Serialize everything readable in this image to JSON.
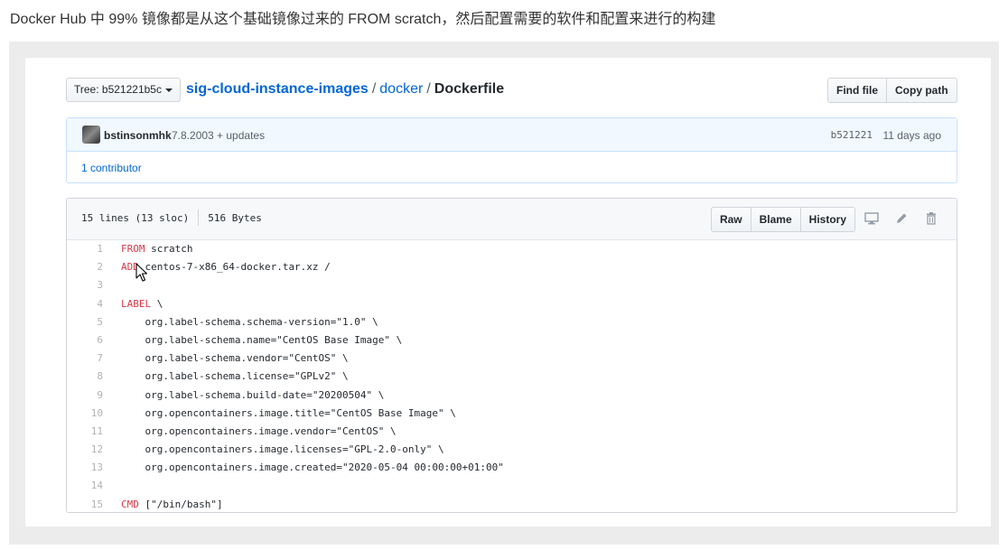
{
  "caption": "Docker Hub 中 99% 镜像都是从这个基础镜像过来的 FROM scratch，然后配置需要的软件和配置来进行的构建",
  "header": {
    "tree_label": "Tree: b521221b5c",
    "repo": "sig-cloud-instance-images",
    "sep1": "/",
    "folder": "docker",
    "sep2": "/",
    "file": "Dockerfile",
    "find_file": "Find file",
    "copy_path": "Copy path"
  },
  "commit": {
    "author": "bstinsonmhk",
    "message": "7.8.2003 + updates",
    "sha": "b521221",
    "ago": "11 days ago",
    "contributors": "1 contributor"
  },
  "file": {
    "lines_info": "15 lines (13 sloc)",
    "size": "516 Bytes",
    "raw": "Raw",
    "blame": "Blame",
    "history": "History",
    "icons": [
      "desktop-icon",
      "pencil-icon",
      "trash-icon"
    ]
  },
  "code_lines": [
    {
      "n": "1",
      "kw": "FROM",
      "rest": " scratch"
    },
    {
      "n": "2",
      "kw": "ADD",
      "rest": " centos-7-x86_64-docker.tar.xz /"
    },
    {
      "n": "3",
      "kw": "",
      "rest": ""
    },
    {
      "n": "4",
      "kw": "LABEL",
      "rest": " \\"
    },
    {
      "n": "5",
      "kw": "",
      "rest": "    org.label-schema.schema-version=\"1.0\" \\"
    },
    {
      "n": "6",
      "kw": "",
      "rest": "    org.label-schema.name=\"CentOS Base Image\" \\"
    },
    {
      "n": "7",
      "kw": "",
      "rest": "    org.label-schema.vendor=\"CentOS\" \\"
    },
    {
      "n": "8",
      "kw": "",
      "rest": "    org.label-schema.license=\"GPLv2\" \\"
    },
    {
      "n": "9",
      "kw": "",
      "rest": "    org.label-schema.build-date=\"20200504\" \\"
    },
    {
      "n": "10",
      "kw": "",
      "rest": "    org.opencontainers.image.title=\"CentOS Base Image\" \\"
    },
    {
      "n": "11",
      "kw": "",
      "rest": "    org.opencontainers.image.vendor=\"CentOS\" \\"
    },
    {
      "n": "12",
      "kw": "",
      "rest": "    org.opencontainers.image.licenses=\"GPL-2.0-only\" \\"
    },
    {
      "n": "13",
      "kw": "",
      "rest": "    org.opencontainers.image.created=\"2020-05-04 00:00:00+01:00\""
    },
    {
      "n": "14",
      "kw": "",
      "rest": ""
    },
    {
      "n": "15",
      "kw": "CMD",
      "rest": " [\"/bin/bash\"]"
    }
  ],
  "colors": {
    "link": "#0366d6",
    "keyword": "#d73a49",
    "line_number": "#b2b2b2",
    "commit_bg": "#f1f8ff"
  }
}
